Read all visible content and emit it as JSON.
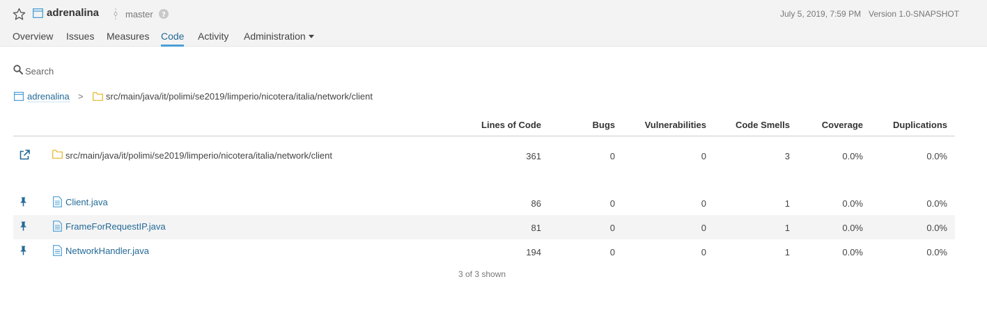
{
  "project": {
    "name": "adrenalina",
    "branch": "master"
  },
  "header_meta": {
    "date": "July 5, 2019, 7:59 PM",
    "version": "Version 1.0-SNAPSHOT"
  },
  "nav": {
    "items": [
      {
        "label": "Overview"
      },
      {
        "label": "Issues"
      },
      {
        "label": "Measures"
      },
      {
        "label": "Code",
        "active": true
      },
      {
        "label": "Activity"
      },
      {
        "label": "Administration"
      }
    ]
  },
  "search": {
    "placeholder": "Search"
  },
  "breadcrumb": {
    "project": "adrenalina",
    "separator": ">",
    "path": "src/main/java/it/polimi/se2019/limperio/nicotera/italia/network/client"
  },
  "table": {
    "columns": [
      "Lines of Code",
      "Bugs",
      "Vulnerabilities",
      "Code Smells",
      "Coverage",
      "Duplications"
    ],
    "base_row": {
      "name": "src/main/java/it/polimi/se2019/limperio/nicotera/italia/network/client",
      "values": [
        "361",
        "0",
        "0",
        "3",
        "0.0%",
        "0.0%"
      ]
    },
    "rows": [
      {
        "name": "Client.java",
        "values": [
          "86",
          "0",
          "0",
          "1",
          "0.0%",
          "0.0%"
        ]
      },
      {
        "name": "FrameForRequestIP.java",
        "values": [
          "81",
          "0",
          "0",
          "1",
          "0.0%",
          "0.0%"
        ]
      },
      {
        "name": "NetworkHandler.java",
        "values": [
          "194",
          "0",
          "0",
          "1",
          "0.0%",
          "0.0%"
        ]
      }
    ]
  },
  "footer": {
    "shown": "3 of 3 shown"
  },
  "colors": {
    "link": "#236a97",
    "accent": "#4b9fd5",
    "folder": "#e6b422"
  }
}
